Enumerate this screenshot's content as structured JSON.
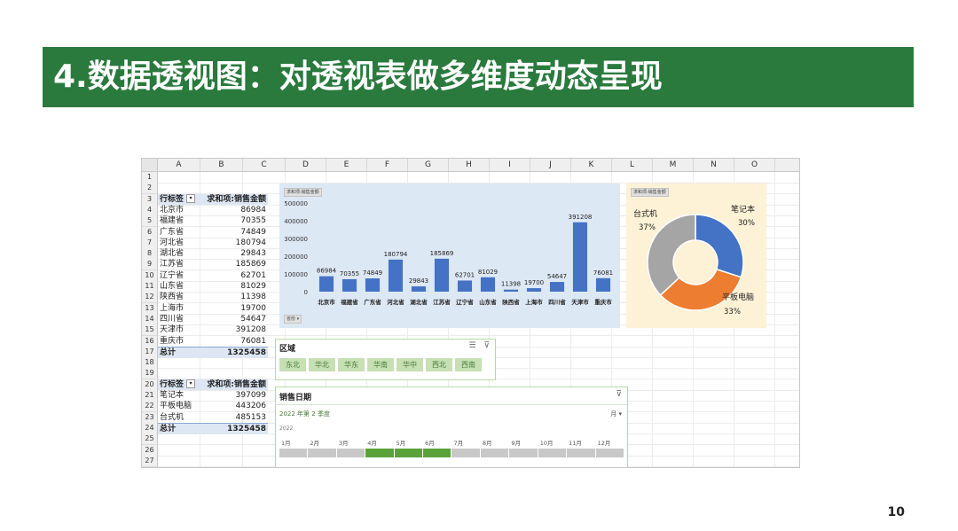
{
  "slide": {
    "title": "4.数据透视图：对透视表做多维度动态呈现",
    "page_number": "10",
    "accent": "#2a7a3e"
  },
  "sheet": {
    "columns": [
      "A",
      "B",
      "C",
      "D",
      "E",
      "F",
      "G",
      "H",
      "I",
      "J",
      "K",
      "L",
      "M",
      "N",
      "O"
    ],
    "rows": [
      "1",
      "2",
      "3",
      "4",
      "5",
      "6",
      "7",
      "8",
      "9",
      "10",
      "11",
      "12",
      "13",
      "14",
      "15",
      "16",
      "17",
      "18",
      "19",
      "20",
      "21",
      "22",
      "23",
      "24",
      "25",
      "26",
      "27"
    ]
  },
  "pivot1": {
    "header": {
      "label": "行标签",
      "value": "求和项:销售金额"
    },
    "rows": [
      {
        "label": "北京市",
        "value": "86984"
      },
      {
        "label": "福建省",
        "value": "70355"
      },
      {
        "label": "广东省",
        "value": "74849"
      },
      {
        "label": "河北省",
        "value": "180794"
      },
      {
        "label": "湖北省",
        "value": "29843"
      },
      {
        "label": "江苏省",
        "value": "185869"
      },
      {
        "label": "辽宁省",
        "value": "62701"
      },
      {
        "label": "山东省",
        "value": "81029"
      },
      {
        "label": "陕西省",
        "value": "11398"
      },
      {
        "label": "上海市",
        "value": "19700"
      },
      {
        "label": "四川省",
        "value": "54647"
      },
      {
        "label": "天津市",
        "value": "391208"
      },
      {
        "label": "重庆市",
        "value": "76081"
      }
    ],
    "total": {
      "label": "总计",
      "value": "1325458"
    }
  },
  "pivot2": {
    "header": {
      "label": "行标签",
      "value": "求和项:销售金额"
    },
    "rows": [
      {
        "label": "笔记本",
        "value": "397099"
      },
      {
        "label": "平板电脑",
        "value": "443206"
      },
      {
        "label": "台式机",
        "value": "485153"
      }
    ],
    "total": {
      "label": "总计",
      "value": "1325458"
    }
  },
  "bar_chart": {
    "field_chip": "求和项:销售金额",
    "axis_chip": "省份"
  },
  "donut_chart": {
    "field_chip": "求和项:销售金额"
  },
  "chart_data": [
    {
      "type": "bar",
      "categories": [
        "北京市",
        "福建省",
        "广东省",
        "河北省",
        "湖北省",
        "江苏省",
        "辽宁省",
        "山东省",
        "陕西省",
        "上海市",
        "四川省",
        "天津市",
        "重庆市"
      ],
      "values": [
        86984,
        70355,
        74849,
        180794,
        29843,
        185869,
        62701,
        81029,
        11398,
        19700,
        54647,
        391208,
        76081
      ],
      "data_labels": [
        "86984",
        "70355",
        "74849",
        "180794",
        "29843",
        "185869",
        "62701",
        "81029",
        "11398",
        "19700",
        "54647",
        "391208",
        "76081"
      ],
      "y_ticks": [
        "0",
        "100000",
        "200000",
        "300000",
        "400000",
        "500000"
      ],
      "ylim": [
        0,
        500000
      ],
      "color": "#4472c4",
      "legend": "none",
      "grid": false
    },
    {
      "type": "pie",
      "donut": true,
      "slices": [
        {
          "label": "笔记本",
          "pct_label": "30%",
          "value": 30,
          "color": "#4472c4"
        },
        {
          "label": "平板电脑",
          "pct_label": "33%",
          "value": 33,
          "color": "#ed7d31"
        },
        {
          "label": "台式机",
          "pct_label": "37%",
          "value": 37,
          "color": "#a5a5a5"
        }
      ]
    }
  ],
  "slicer": {
    "title": "区域",
    "items": [
      "东北",
      "华北",
      "华东",
      "华南",
      "华中",
      "西北",
      "西南"
    ],
    "color": "#c6e0b4"
  },
  "timeline": {
    "title": "销售日期",
    "range_label": "2022 年第 2 季度",
    "level": "月 ▾",
    "year": "2022",
    "months": [
      "1月",
      "2月",
      "3月",
      "4月",
      "5月",
      "6月",
      "7月",
      "8月",
      "9月",
      "10月",
      "11月",
      "12月"
    ],
    "selected": [
      "4月",
      "5月",
      "6月"
    ],
    "color": "#5aa33a"
  },
  "icons": {
    "multi_select": "multi-select-icon",
    "clear_filter": "clear-filter-icon"
  }
}
